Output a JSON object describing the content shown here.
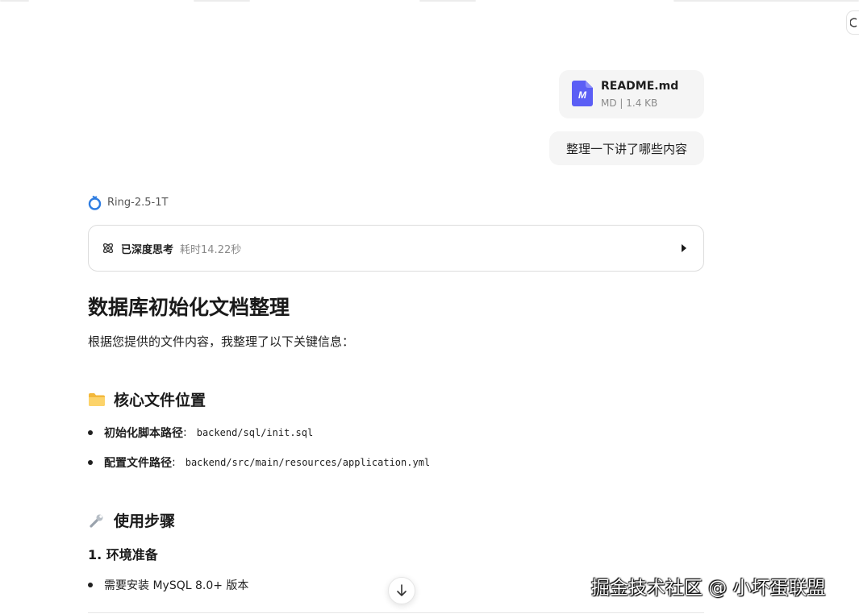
{
  "attachment": {
    "name": "README.md",
    "meta": "MD | 1.4 KB",
    "icon": "markdown-file-icon",
    "icon_letter": "M",
    "icon_color": "#5b5ef5"
  },
  "user_message": "整理一下讲了哪些内容",
  "model": {
    "name": "Ring-2.5-1T",
    "icon": "ring-logo-icon",
    "icon_color": "#2f7de1"
  },
  "thinking": {
    "label": "已深度思考",
    "duration": "耗时14.22秒",
    "icon": "atom-icon",
    "toggle_icon": "caret-right-icon"
  },
  "response": {
    "title": "数据库初始化文档整理",
    "intro": "根据您提供的文件内容，我整理了以下关键信息：",
    "sections": [
      {
        "icon": "folder-icon",
        "heading": "核心文件位置",
        "items": [
          {
            "label": "初始化脚本路径",
            "colon": ":",
            "code": "backend/sql/init.sql"
          },
          {
            "label": "配置文件路径",
            "colon": ":",
            "code": "backend/src/main/resources/application.yml"
          }
        ]
      },
      {
        "icon": "wrench-icon",
        "heading": "使用步骤",
        "subheading": "1. 环境准备",
        "items": [
          {
            "text": "需要安装 MySQL 8.0+ 版本"
          }
        ]
      }
    ]
  },
  "scroll_down": {
    "icon": "arrow-down-icon"
  },
  "watermark": "掘金技术社区 @ 小坏蛋联盟"
}
